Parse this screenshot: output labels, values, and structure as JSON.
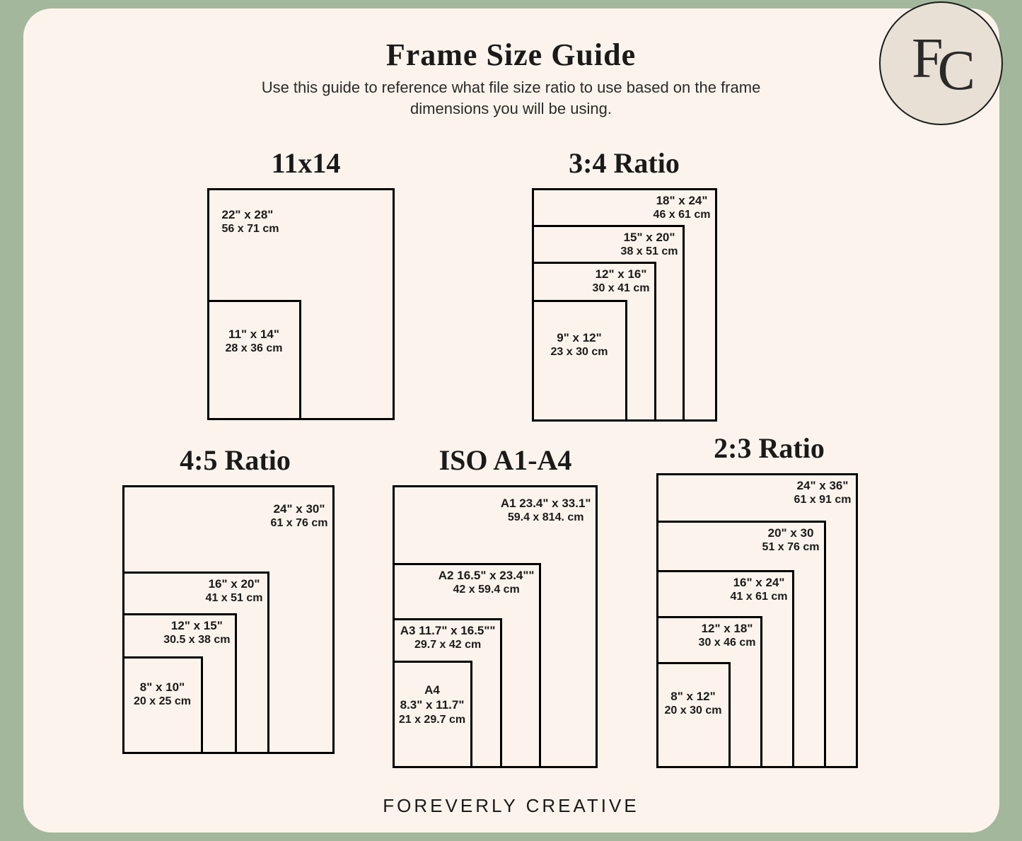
{
  "brand": {
    "letters": "FC",
    "footer": "FOREVERLY CREATIVE"
  },
  "title": "Frame Size Guide",
  "subtitle1": "Use this guide to reference what file size ratio to use based on the frame",
  "subtitle2": "dimensions you will be using.",
  "sections": {
    "s11x14": {
      "title": "11x14",
      "b0_in": "22\" x 28\"",
      "b0_cm": "56 x 71 cm",
      "b1_in": "11\" x 14\"",
      "b1_cm": "28 x 36 cm"
    },
    "s3_4": {
      "title": "3:4 Ratio",
      "b0_in": "18\" x 24\"",
      "b0_cm": "46 x 61 cm",
      "b1_in": "15\" x 20\"",
      "b1_cm": "38 x 51 cm",
      "b2_in": "12\" x 16\"",
      "b2_cm": "30 x 41 cm",
      "b3_in": "9\" x 12\"",
      "b3_cm": "23 x 30 cm"
    },
    "s4_5": {
      "title": "4:5 Ratio",
      "b0_in": "24\" x 30\"",
      "b0_cm": "61 x 76 cm",
      "b1_in": "16\" x 20\"",
      "b1_cm": "41 x 51 cm",
      "b2_in": "12\" x 15\"",
      "b2_cm": "30.5 x 38 cm",
      "b3_in": "8\" x 10\"",
      "b3_cm": "20 x 25 cm"
    },
    "sIso": {
      "title": "ISO A1-A4",
      "b0_in": "A1 23.4\" x 33.1\"",
      "b0_cm": "59.4 x 814. cm",
      "b1_in": "A2 16.5\" x 23.4\"\"",
      "b1_cm": "42 x 59.4 cm",
      "b2_in": "A3 11.7\" x 16.5\"\"",
      "b2_cm": "29.7 x 42 cm",
      "b3_a": "A4",
      "b3_in": "8.3\" x 11.7\"",
      "b3_cm": "21 x 29.7 cm"
    },
    "s2_3": {
      "title": "2:3 Ratio",
      "b0_in": "24\" x 36\"",
      "b0_cm": "61 x 91 cm",
      "b1_in": "20\" x 30",
      "b1_cm": "51 x 76 cm",
      "b2_in": "16\" x 24\"",
      "b2_cm": "41 x 61 cm",
      "b3_in": "12\" x 18\"",
      "b3_cm": "30 x 46 cm",
      "b4_in": "8\" x 12\"",
      "b4_cm": "20 x 30 cm"
    }
  }
}
